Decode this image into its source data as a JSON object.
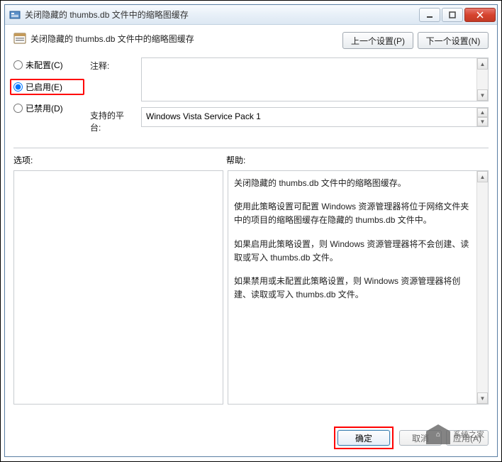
{
  "window": {
    "title": "关闭隐藏的 thumbs.db 文件中的缩略图缓存"
  },
  "header": {
    "title": "关闭隐藏的 thumbs.db 文件中的缩略图缓存",
    "prev_button": "上一个设置(P)",
    "next_button": "下一个设置(N)"
  },
  "radios": {
    "not_configured": "未配置(C)",
    "enabled": "已启用(E)",
    "disabled": "已禁用(D)",
    "selected": "enabled"
  },
  "fields": {
    "comment_label": "注释:",
    "comment_value": "",
    "platform_label": "支持的平台:",
    "platform_value": "Windows Vista Service Pack 1"
  },
  "labels": {
    "options": "选项:",
    "help": "帮助:"
  },
  "help": {
    "p1": "关闭隐藏的 thumbs.db 文件中的缩略图缓存。",
    "p2": "使用此策略设置可配置 Windows 资源管理器将位于网络文件夹中的项目的缩略图缓存在隐藏的 thumbs.db 文件中。",
    "p3": "如果启用此策略设置，则 Windows 资源管理器将不会创建、读取或写入 thumbs.db 文件。",
    "p4": "如果禁用或未配置此策略设置，则 Windows 资源管理器将创建、读取或写入 thumbs.db 文件。"
  },
  "footer": {
    "ok": "确定",
    "cancel": "取消",
    "apply": "应用(A)"
  },
  "watermark": {
    "text": "系统之家"
  }
}
